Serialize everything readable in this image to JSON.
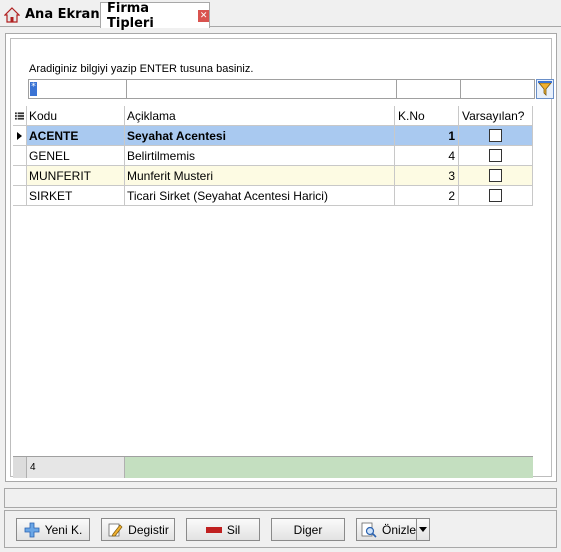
{
  "tabs": [
    {
      "label": "Ana Ekran",
      "icon": "home-icon"
    },
    {
      "label": "Firma Tipleri",
      "icon": "close-icon"
    }
  ],
  "hint": "Aradiginiz bilgiyi yazip ENTER tusuna basiniz.",
  "grid": {
    "columns": [
      "Kodu",
      "Açiklama",
      "K.No",
      "Varsayılan?"
    ],
    "rows": [
      {
        "kodu": "ACENTE",
        "aciklama": "Seyahat Acentesi",
        "kno": "1",
        "varsayilan": false
      },
      {
        "kodu": "GENEL",
        "aciklama": "Belirtilmemis",
        "kno": "4",
        "varsayilan": false
      },
      {
        "kodu": "MUNFERIT",
        "aciklama": "Munferit Musteri",
        "kno": "3",
        "varsayilan": false
      },
      {
        "kodu": "SIRKET",
        "aciklama": "Ticari Sirket (Seyahat Acentesi Harici)",
        "kno": "2",
        "varsayilan": false
      }
    ],
    "record_count": "4"
  },
  "buttons": {
    "yeni": "Yeni K.",
    "degistir": "Degistir",
    "sil": "Sil",
    "diger": "Diger",
    "onizle": "Önizle"
  },
  "colors": {
    "selected_row": "#a9c9f0",
    "alt_row": "#fdfbe3",
    "footer": "#c4dfc0"
  }
}
